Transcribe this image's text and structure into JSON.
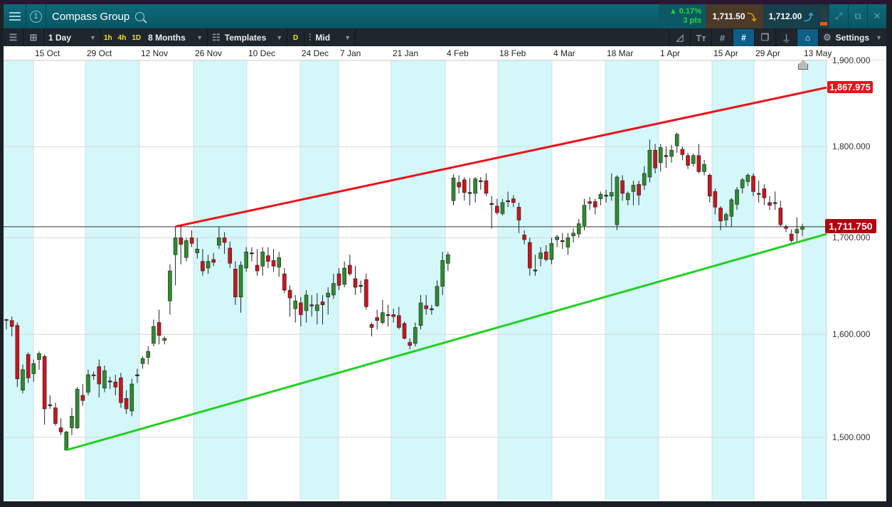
{
  "header": {
    "title": "Compass Group",
    "window_number": "1",
    "change_pct": "▲ 0.17%",
    "change_pts": "3 pts",
    "sell": "1,711.50",
    "buy": "1,712.00"
  },
  "toolbar": {
    "interval": "1 Day",
    "quick": [
      "1h",
      "4h",
      "1D"
    ],
    "range": "8 Months",
    "templates": "Templates",
    "d": "D",
    "price_type": "Mid",
    "settings": "Settings"
  },
  "colors": {
    "up": "#2e8b2e",
    "down": "#c8161d",
    "band": "#d4f7fa",
    "resistance": "#e8141b",
    "support": "#22d022"
  },
  "chart_data": {
    "type": "candlestick",
    "instrument": "Compass Group",
    "x_tick_labels": [
      "15 Oct",
      "29 Oct",
      "12 Nov",
      "26 Nov",
      "10 Dec",
      "24 Dec",
      "7 Jan",
      "21 Jan",
      "4 Feb",
      "18 Feb",
      "4 Mar",
      "18 Mar",
      "1 Apr",
      "15 Apr",
      "29 Apr",
      "13 May"
    ],
    "y_tick_labels": [
      "1,900.000",
      "1,800.000",
      "1,700.000",
      "1,600.000",
      "1,500.000"
    ],
    "y_ticks": [
      1900,
      1800,
      1700,
      1600,
      1500
    ],
    "yscale": "log",
    "ylim": [
      1450,
      1910
    ],
    "current_price": 1711.75,
    "current_price_label": "1,711.750",
    "resistance": {
      "start_candle": 31,
      "start_price": 1712,
      "end_price": 1867.975,
      "label": "1,867.975"
    },
    "support": {
      "start_candle": 11,
      "start_price": 1488,
      "end_price": 1704
    },
    "ohlc": [
      [
        1614,
        1616,
        1605,
        1615
      ],
      [
        1614,
        1618,
        1598,
        1608
      ],
      [
        1609,
        1612,
        1548,
        1556
      ],
      [
        1545,
        1570,
        1542,
        1565
      ],
      [
        1580,
        1582,
        1552,
        1557
      ],
      [
        1561,
        1575,
        1553,
        1571
      ],
      [
        1575,
        1583,
        1565,
        1581
      ],
      [
        1578,
        1580,
        1512,
        1527
      ],
      [
        1531,
        1540,
        1527,
        1531
      ],
      [
        1528,
        1533,
        1511,
        1513
      ],
      [
        1509,
        1518,
        1502,
        1505
      ],
      [
        1488,
        1506,
        1488,
        1505
      ],
      [
        1509,
        1528,
        1502,
        1520
      ],
      [
        1509,
        1548,
        1508,
        1546
      ],
      [
        1540,
        1551,
        1530,
        1535
      ],
      [
        1543,
        1565,
        1540,
        1560
      ],
      [
        1560,
        1563,
        1555,
        1559
      ],
      [
        1568,
        1575,
        1538,
        1551
      ],
      [
        1547,
        1569,
        1543,
        1564
      ],
      [
        1554,
        1558,
        1546,
        1554
      ],
      [
        1553,
        1560,
        1540,
        1548
      ],
      [
        1557,
        1562,
        1528,
        1533
      ],
      [
        1537,
        1545,
        1522,
        1527
      ],
      [
        1525,
        1556,
        1520,
        1551
      ],
      [
        1560,
        1566,
        1552,
        1560
      ],
      [
        1571,
        1578,
        1566,
        1576
      ],
      [
        1577,
        1588,
        1570,
        1583
      ],
      [
        1591,
        1615,
        1588,
        1608
      ],
      [
        1612,
        1625,
        1590,
        1599
      ],
      [
        1594,
        1598,
        1590,
        1596
      ],
      [
        1634,
        1672,
        1620,
        1665
      ],
      [
        1682,
        1712,
        1650,
        1700
      ],
      [
        1700,
        1712,
        1672,
        1693
      ],
      [
        1679,
        1700,
        1675,
        1697
      ],
      [
        1700,
        1708,
        1690,
        1694
      ],
      [
        1684,
        1700,
        1678,
        1688
      ],
      [
        1675,
        1688,
        1660,
        1665
      ],
      [
        1668,
        1682,
        1662,
        1675
      ],
      [
        1677,
        1684,
        1670,
        1674
      ],
      [
        1692,
        1712,
        1688,
        1700
      ],
      [
        1700,
        1706,
        1683,
        1695
      ],
      [
        1689,
        1696,
        1668,
        1673
      ],
      [
        1667,
        1675,
        1630,
        1638
      ],
      [
        1638,
        1675,
        1622,
        1671
      ],
      [
        1668,
        1690,
        1664,
        1685
      ],
      [
        1684,
        1690,
        1675,
        1684
      ],
      [
        1671,
        1688,
        1660,
        1665
      ],
      [
        1670,
        1690,
        1660,
        1685
      ],
      [
        1681,
        1690,
        1668,
        1675
      ],
      [
        1676,
        1688,
        1664,
        1670
      ],
      [
        1669,
        1685,
        1659,
        1679
      ],
      [
        1662,
        1668,
        1642,
        1645
      ],
      [
        1645,
        1650,
        1618,
        1637
      ],
      [
        1626,
        1640,
        1612,
        1634
      ],
      [
        1632,
        1638,
        1608,
        1620
      ],
      [
        1624,
        1645,
        1612,
        1640
      ],
      [
        1630,
        1640,
        1618,
        1630
      ],
      [
        1624,
        1642,
        1610,
        1630
      ],
      [
        1633,
        1640,
        1610,
        1630
      ],
      [
        1638,
        1648,
        1620,
        1642
      ],
      [
        1640,
        1662,
        1636,
        1652
      ],
      [
        1662,
        1668,
        1645,
        1650
      ],
      [
        1651,
        1675,
        1648,
        1668
      ],
      [
        1671,
        1682,
        1660,
        1662
      ],
      [
        1657,
        1670,
        1640,
        1648
      ],
      [
        1650,
        1655,
        1642,
        1650
      ],
      [
        1656,
        1662,
        1625,
        1628
      ],
      [
        1610,
        1612,
        1598,
        1607
      ],
      [
        1617,
        1625,
        1605,
        1614
      ],
      [
        1612,
        1635,
        1610,
        1622
      ],
      [
        1620,
        1630,
        1608,
        1620
      ],
      [
        1620,
        1626,
        1612,
        1618
      ],
      [
        1619,
        1628,
        1605,
        1607
      ],
      [
        1611,
        1613,
        1595,
        1596
      ],
      [
        1592,
        1596,
        1585,
        1589
      ],
      [
        1591,
        1612,
        1588,
        1607
      ],
      [
        1609,
        1640,
        1605,
        1632
      ],
      [
        1629,
        1640,
        1620,
        1626
      ],
      [
        1626,
        1630,
        1620,
        1626
      ],
      [
        1629,
        1655,
        1628,
        1649
      ],
      [
        1649,
        1685,
        1640,
        1676
      ],
      [
        1673,
        1685,
        1665,
        1682
      ],
      [
        1740,
        1769,
        1735,
        1765
      ],
      [
        1760,
        1768,
        1748,
        1755
      ],
      [
        1763,
        1766,
        1740,
        1749
      ],
      [
        1749,
        1765,
        1735,
        1749
      ],
      [
        1748,
        1766,
        1738,
        1764
      ],
      [
        1762,
        1766,
        1752,
        1762
      ],
      [
        1762,
        1770,
        1745,
        1748
      ],
      [
        1737,
        1745,
        1710,
        1737
      ],
      [
        1734,
        1742,
        1725,
        1727
      ],
      [
        1726,
        1742,
        1724,
        1738
      ],
      [
        1740,
        1750,
        1733,
        1740
      ],
      [
        1742,
        1746,
        1733,
        1738
      ],
      [
        1733,
        1738,
        1705,
        1719
      ],
      [
        1703,
        1708,
        1693,
        1698
      ],
      [
        1695,
        1700,
        1660,
        1668
      ],
      [
        1666,
        1682,
        1660,
        1666
      ],
      [
        1678,
        1690,
        1670,
        1684
      ],
      [
        1685,
        1692,
        1675,
        1677
      ],
      [
        1677,
        1700,
        1672,
        1694
      ],
      [
        1698,
        1703,
        1690,
        1701
      ],
      [
        1697,
        1705,
        1688,
        1697
      ],
      [
        1690,
        1705,
        1682,
        1700
      ],
      [
        1702,
        1710,
        1695,
        1705
      ],
      [
        1704,
        1720,
        1700,
        1715
      ],
      [
        1713,
        1742,
        1708,
        1735
      ],
      [
        1739,
        1744,
        1730,
        1737
      ],
      [
        1739,
        1742,
        1725,
        1733
      ],
      [
        1742,
        1750,
        1735,
        1747
      ],
      [
        1746,
        1752,
        1738,
        1746
      ],
      [
        1745,
        1770,
        1740,
        1749
      ],
      [
        1714,
        1768,
        1708,
        1766
      ],
      [
        1762,
        1768,
        1740,
        1748
      ],
      [
        1741,
        1750,
        1735,
        1748
      ],
      [
        1750,
        1762,
        1735,
        1757
      ],
      [
        1758,
        1762,
        1735,
        1746
      ],
      [
        1757,
        1778,
        1752,
        1770
      ],
      [
        1766,
        1808,
        1760,
        1796
      ],
      [
        1796,
        1803,
        1770,
        1776
      ],
      [
        1782,
        1803,
        1772,
        1799
      ],
      [
        1790,
        1800,
        1776,
        1790
      ],
      [
        1789,
        1802,
        1782,
        1796
      ],
      [
        1801,
        1816,
        1793,
        1814
      ],
      [
        1797,
        1800,
        1785,
        1791
      ],
      [
        1790,
        1793,
        1775,
        1779
      ],
      [
        1781,
        1792,
        1778,
        1790
      ],
      [
        1790,
        1803,
        1770,
        1772
      ],
      [
        1772,
        1785,
        1768,
        1780
      ],
      [
        1768,
        1770,
        1738,
        1745
      ],
      [
        1750,
        1753,
        1725,
        1733
      ],
      [
        1732,
        1734,
        1708,
        1718
      ],
      [
        1719,
        1727,
        1712,
        1725
      ],
      [
        1723,
        1743,
        1712,
        1741
      ],
      [
        1736,
        1755,
        1730,
        1752
      ],
      [
        1754,
        1765,
        1748,
        1763
      ],
      [
        1761,
        1770,
        1756,
        1768
      ],
      [
        1767,
        1770,
        1745,
        1750
      ],
      [
        1748,
        1762,
        1738,
        1748
      ],
      [
        1753,
        1758,
        1735,
        1743
      ],
      [
        1738,
        1745,
        1730,
        1735
      ],
      [
        1738,
        1750,
        1730,
        1738
      ],
      [
        1732,
        1740,
        1712,
        1714
      ],
      [
        1712,
        1714,
        1706,
        1710
      ],
      [
        1704,
        1709,
        1695,
        1697
      ],
      [
        1705,
        1722,
        1695,
        1709
      ],
      [
        1709,
        1715,
        1702,
        1712
      ]
    ]
  }
}
